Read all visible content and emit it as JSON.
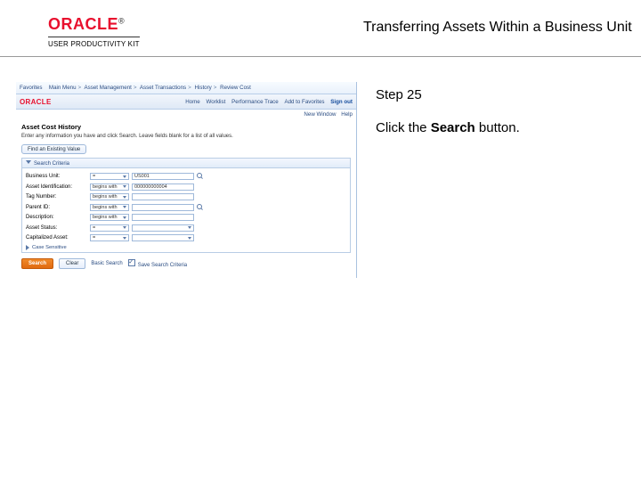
{
  "header": {
    "brand": "ORACLE",
    "brand_suffix": "®",
    "subbrand": "USER PRODUCTIVITY KIT",
    "doc_title": "Transferring Assets Within a Business Unit"
  },
  "right_panel": {
    "step_label": "Step 25",
    "instr_prefix": "Click the ",
    "instr_bold": "Search",
    "instr_suffix": " button."
  },
  "app": {
    "breadcrumb": [
      "Favorites",
      "Main Menu",
      "Asset Management",
      "Asset Transactions",
      "History",
      "Review Cost"
    ],
    "brand": "ORACLE",
    "header_links": {
      "home": "Home",
      "worklist": "Worklist",
      "perf": "Performance Trace",
      "addto": "Add to Favorites",
      "signout": "Sign out"
    },
    "subrow": {
      "new_window": "New Window",
      "help": "Help"
    },
    "page_title": "Asset Cost History",
    "page_note": "Enter any information you have and click Search. Leave fields blank for a list of all values.",
    "tab": "Find an Existing Value",
    "panel_title": "Search Criteria",
    "fields": [
      {
        "label": "Business Unit:",
        "op": "=",
        "value": "US001",
        "lookup": true
      },
      {
        "label": "Asset Identification:",
        "op": "begins with",
        "value": "000000000004",
        "lookup": false
      },
      {
        "label": "Tag Number:",
        "op": "begins with",
        "value": "",
        "lookup": false
      },
      {
        "label": "Parent ID:",
        "op": "begins with",
        "value": "",
        "lookup": true
      },
      {
        "label": "Description:",
        "op": "begins with",
        "value": "",
        "lookup": false
      },
      {
        "label": "Asset Status:",
        "op": "=",
        "value": "",
        "dropdown": true
      },
      {
        "label": "Capitalized Asset:",
        "op": "=",
        "value": "",
        "dropdown": true
      }
    ],
    "case_link": "Case Sensitive",
    "buttons": {
      "search": "Search",
      "clear": "Clear",
      "basic": "Basic Search",
      "save_criteria": "Save Search Criteria"
    }
  }
}
